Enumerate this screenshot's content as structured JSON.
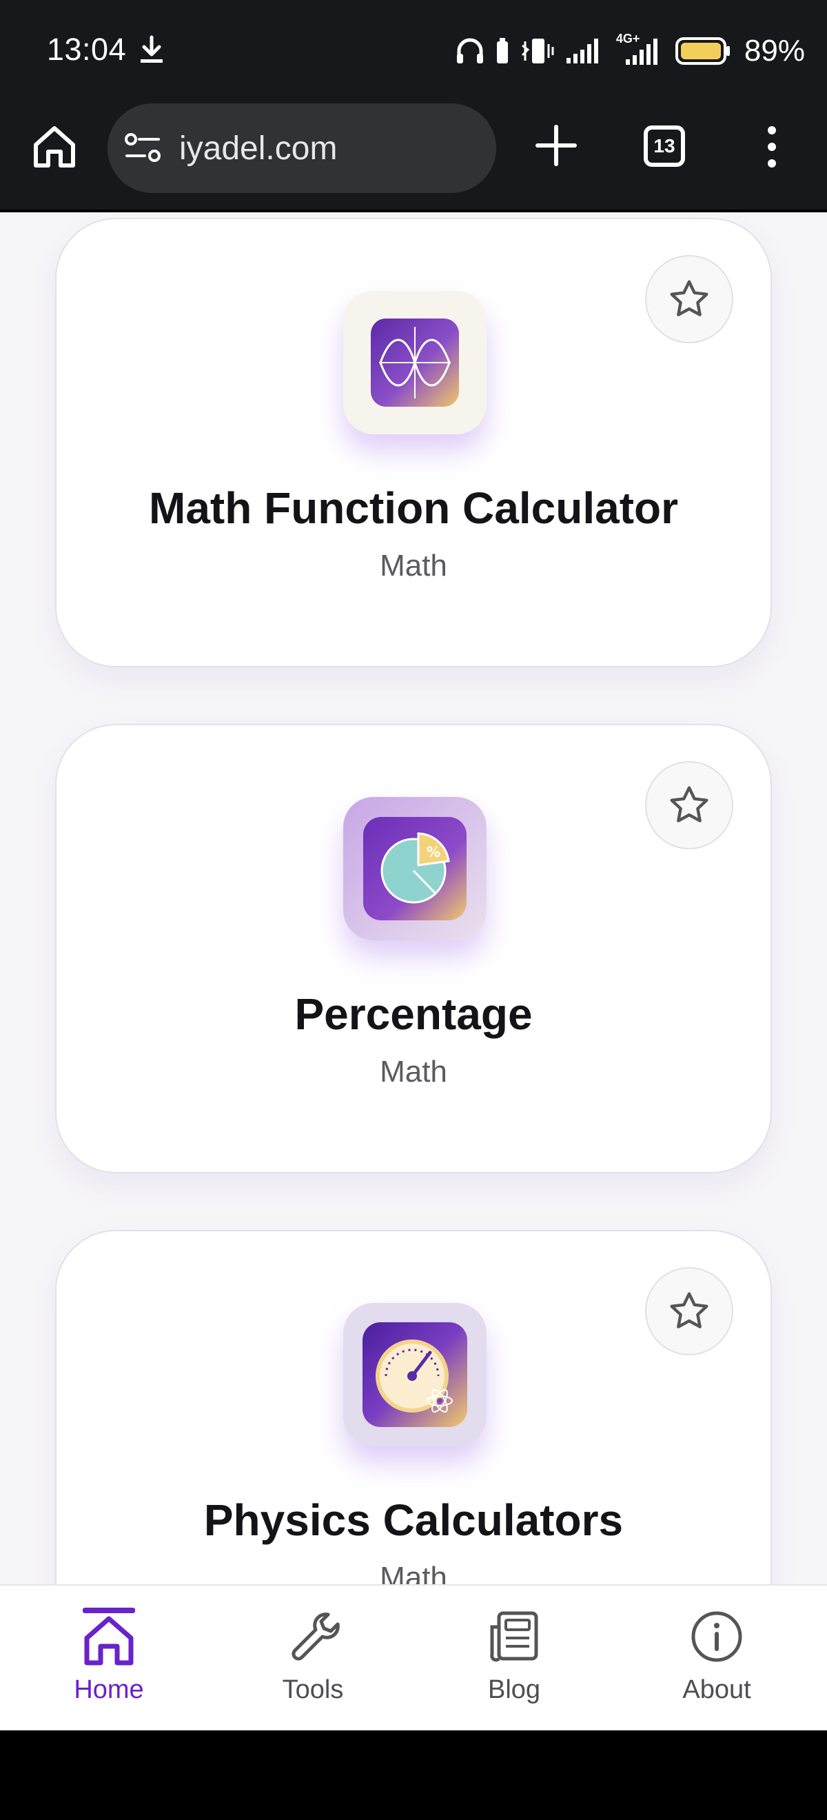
{
  "status_bar": {
    "time": "13:04",
    "battery_percent": "89%",
    "network_label": "4G+"
  },
  "browser": {
    "url": "iyadel.com",
    "tab_count": "13"
  },
  "cards": [
    {
      "title": "Math Function Calculator",
      "category": "Math",
      "icon": "function-graph-icon"
    },
    {
      "title": "Percentage",
      "category": "Math",
      "icon": "pie-chart-percent-icon"
    },
    {
      "title": "Physics Calculators",
      "category": "Math",
      "icon": "gauge-atom-icon"
    }
  ],
  "bottom_nav": {
    "items": [
      {
        "label": "Home",
        "icon": "home-icon",
        "active": true
      },
      {
        "label": "Tools",
        "icon": "wrench-icon",
        "active": false
      },
      {
        "label": "Blog",
        "icon": "newspaper-icon",
        "active": false
      },
      {
        "label": "About",
        "icon": "info-icon",
        "active": false
      }
    ]
  },
  "colors": {
    "accent": "#6a22c9",
    "status_bar_bg": "#17181b",
    "page_bg": "#f6f5f8"
  }
}
